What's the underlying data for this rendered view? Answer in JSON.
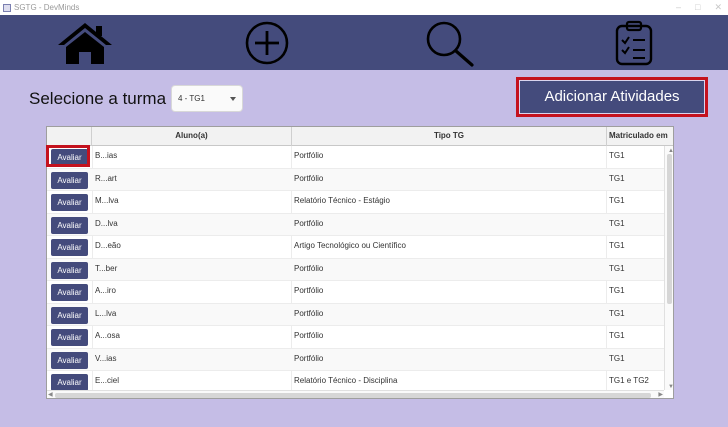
{
  "window": {
    "title": "SGTG - DevMinds",
    "app_icon": "app-window-icon"
  },
  "nav": [
    {
      "name": "home",
      "icon": "home-icon"
    },
    {
      "name": "add",
      "icon": "plus-circle-icon"
    },
    {
      "name": "search",
      "icon": "search-icon"
    },
    {
      "name": "clipboard",
      "icon": "clipboard-checklist-icon"
    }
  ],
  "turma": {
    "label": "Selecione a turma",
    "selected": "4 - TG1"
  },
  "actions": {
    "add_activities_label": "Adicionar Atividades"
  },
  "table": {
    "headers": {
      "action": "",
      "aluno": "Aluno(a)",
      "tipo": "Tipo TG",
      "matriculado": "Matriculado em"
    },
    "button_label": "Avaliar",
    "rows": [
      {
        "aluno": "B...ias",
        "tipo": "Portfólio",
        "matriculado": "TG1"
      },
      {
        "aluno": "R...art",
        "tipo": "Portfólio",
        "matriculado": "TG1"
      },
      {
        "aluno": "M...lva",
        "tipo": "Relatório Técnico - Estágio",
        "matriculado": "TG1"
      },
      {
        "aluno": "D...lva",
        "tipo": "Portfólio",
        "matriculado": "TG1"
      },
      {
        "aluno": "D...eão",
        "tipo": "Artigo Tecnológico ou Científico",
        "matriculado": "TG1"
      },
      {
        "aluno": "T...ber",
        "tipo": "Portfólio",
        "matriculado": "TG1"
      },
      {
        "aluno": "A...iro",
        "tipo": "Portfólio",
        "matriculado": "TG1"
      },
      {
        "aluno": "L...lva",
        "tipo": "Portfólio",
        "matriculado": "TG1"
      },
      {
        "aluno": "A...osa",
        "tipo": "Portfólio",
        "matriculado": "TG1"
      },
      {
        "aluno": "V...ias",
        "tipo": "Portfólio",
        "matriculado": "TG1"
      },
      {
        "aluno": "E...ciel",
        "tipo": "Relatório Técnico - Disciplina",
        "matriculado": "TG1 e TG2"
      }
    ]
  },
  "colors": {
    "navbar": "#444b7c",
    "background": "#c5bde6",
    "highlight": "#c4121e",
    "button": "#444b7c"
  }
}
